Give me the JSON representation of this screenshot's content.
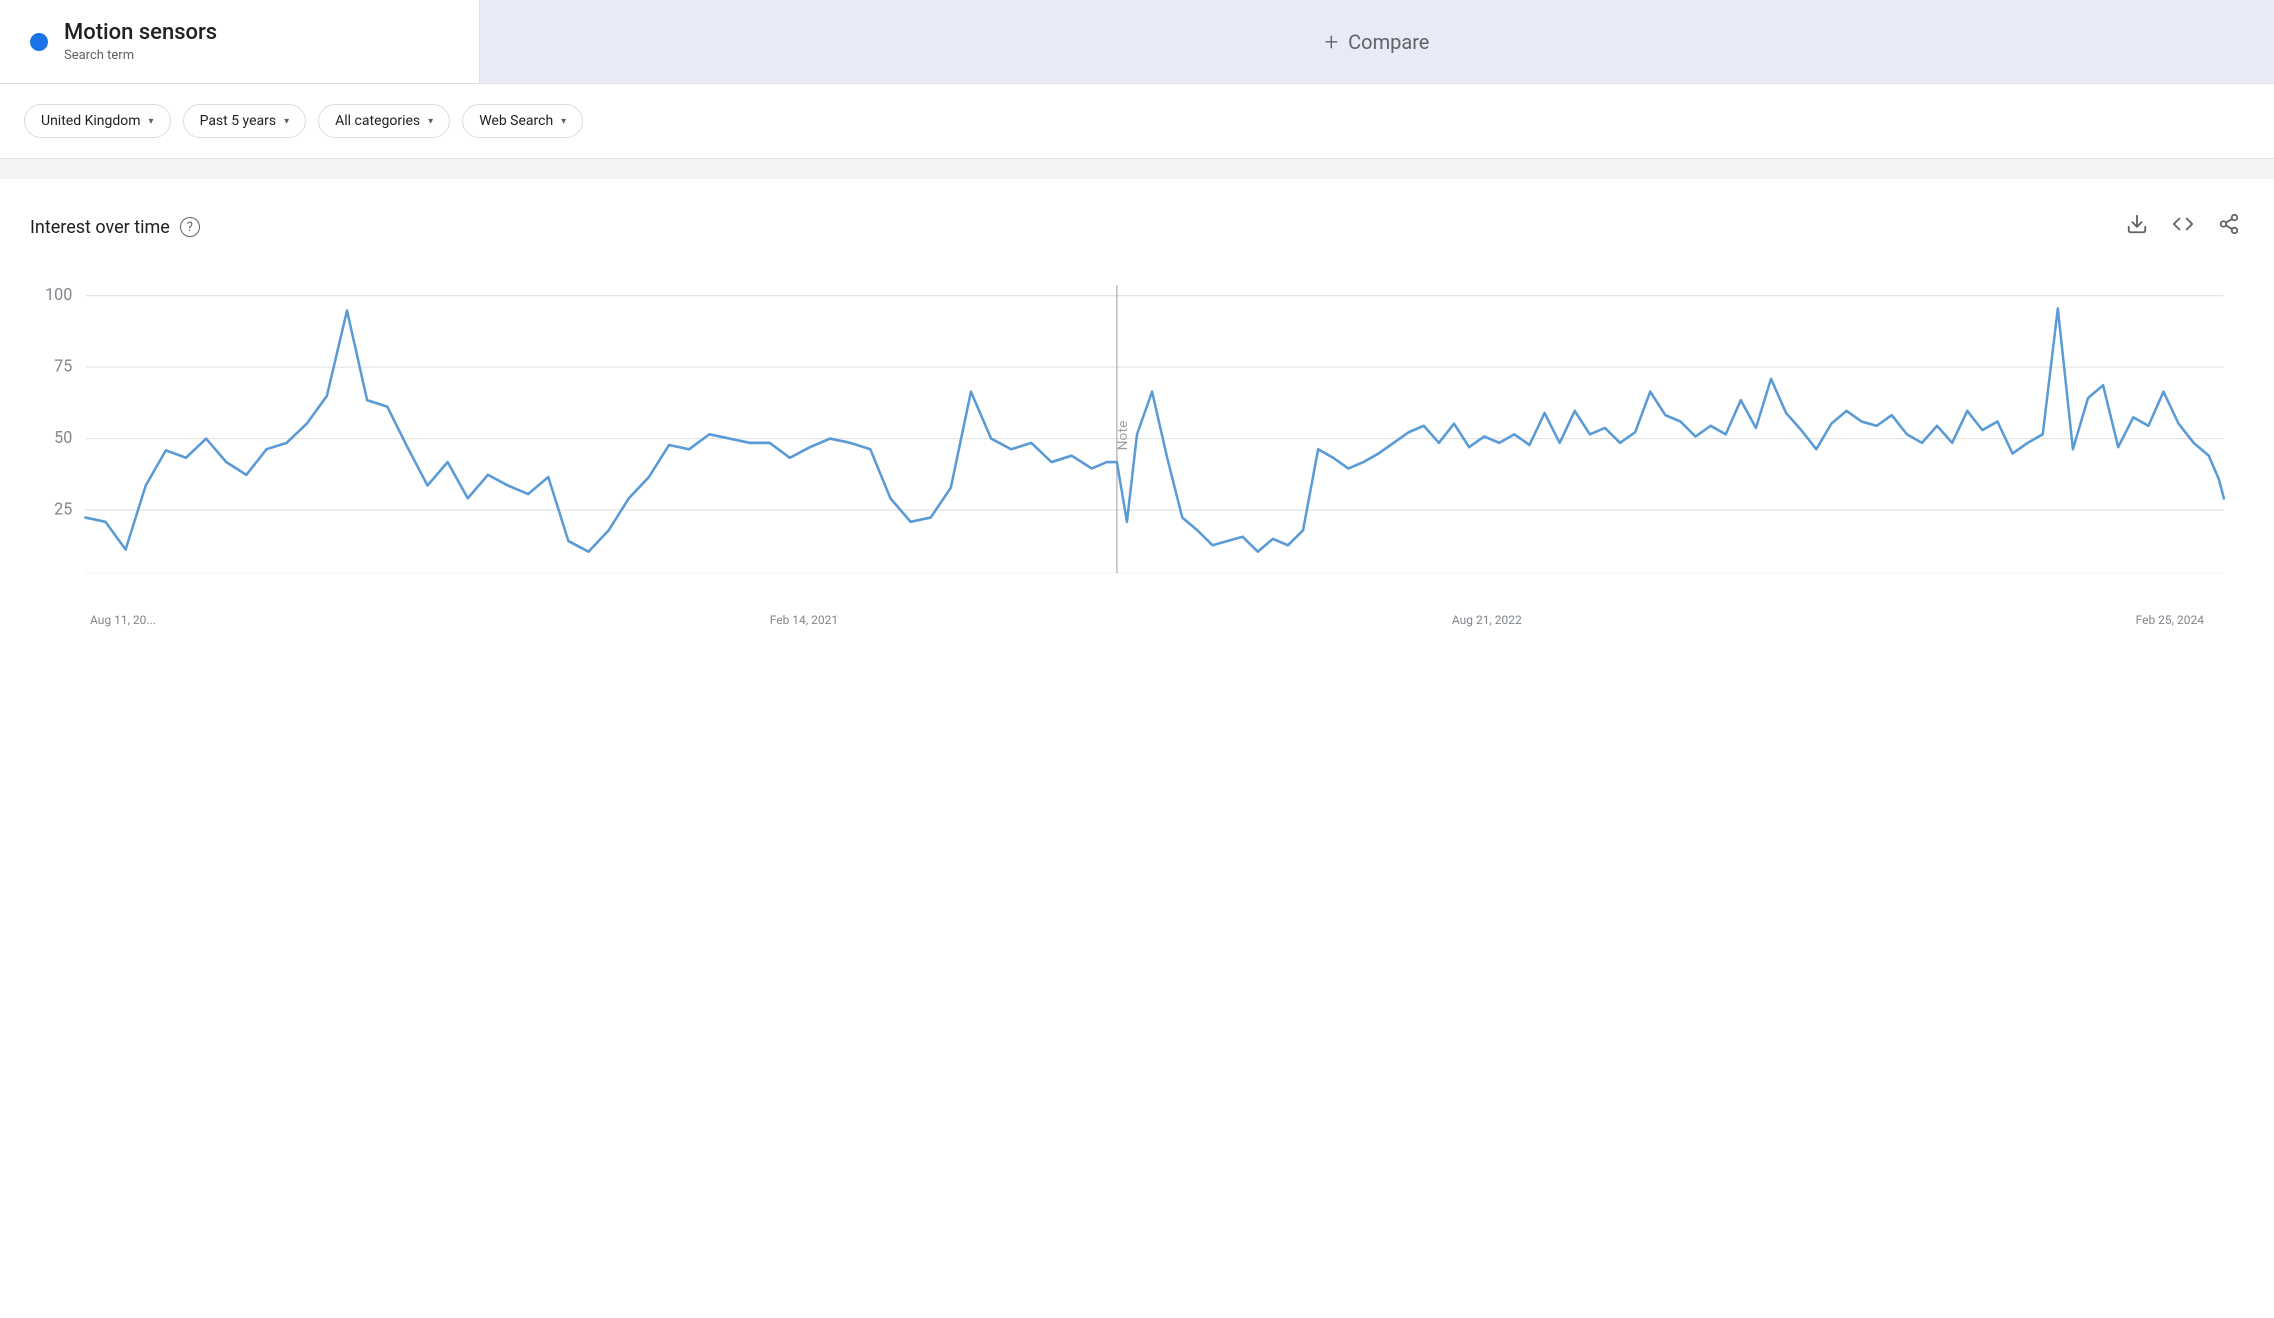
{
  "header": {
    "blue_dot_color": "#1a73e8",
    "search_term_title": "Motion sensors",
    "search_term_subtitle": "Search term",
    "compare_plus": "+",
    "compare_label": "Compare"
  },
  "filters": [
    {
      "id": "region",
      "label": "United Kingdom"
    },
    {
      "id": "time",
      "label": "Past 5 years"
    },
    {
      "id": "category",
      "label": "All categories"
    },
    {
      "id": "type",
      "label": "Web Search"
    }
  ],
  "chart": {
    "title": "Interest over time",
    "help_icon": "?",
    "y_labels": [
      "100",
      "75",
      "50",
      "25"
    ],
    "x_labels": [
      "Aug 11, 20...",
      "Feb 14, 2021",
      "Aug 21, 2022",
      "Feb 25, 2024"
    ],
    "note_label": "Note",
    "line_color": "#5b9bd5",
    "actions": {
      "download": "⬇",
      "embed": "<>",
      "share": "↗"
    }
  }
}
